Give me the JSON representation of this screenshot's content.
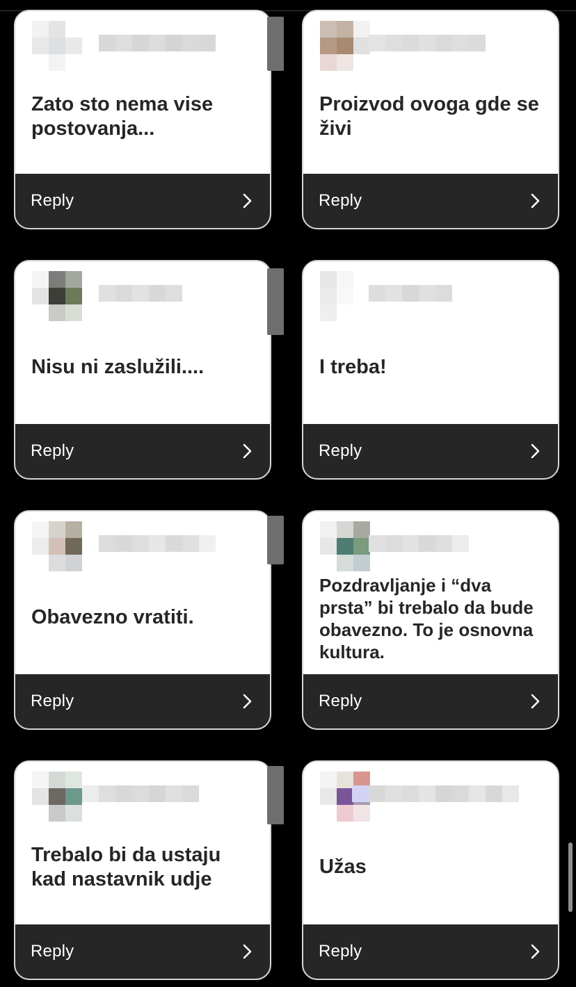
{
  "comments": [
    {
      "text": "Zato sto nema vise postovanja...",
      "reply_label": "Reply"
    },
    {
      "text": "Proizvod ovoga gde se živi",
      "reply_label": "Reply"
    },
    {
      "text": "Nisu ni zaslužili....",
      "reply_label": "Reply"
    },
    {
      "text": "I treba!",
      "reply_label": "Reply"
    },
    {
      "text": "Obavezno vratiti.",
      "reply_label": "Reply"
    },
    {
      "text": "Pozdravljanje i “dva prsta” bi trebalo da bude obavezno. To je osnovna kultura.",
      "reply_label": "Reply"
    },
    {
      "text": "Trebalo bi da ustaju kad nastavnik udje",
      "reply_label": "Reply"
    },
    {
      "text": "Užas",
      "reply_label": "Reply"
    }
  ],
  "icons": {
    "reply_chevron": "chevron-right-icon",
    "avatar": "blurred-avatar"
  },
  "colors": {
    "background": "#000000",
    "card": "#ffffff",
    "reply_bar": "#262626",
    "text": "#262626"
  }
}
